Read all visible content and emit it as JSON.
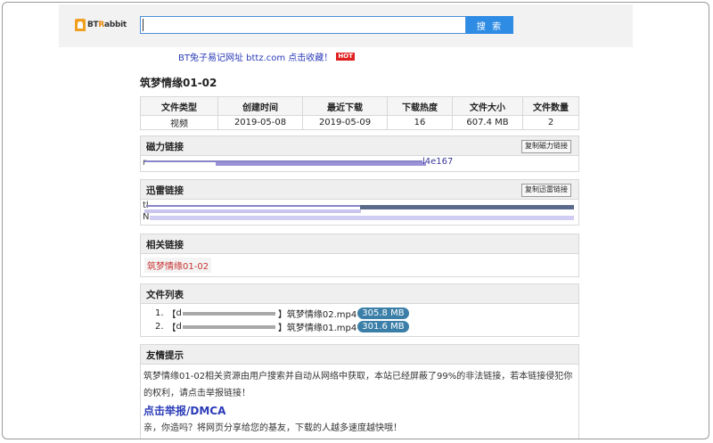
{
  "logo": {
    "text_prefix": "BT",
    "text_r": "R",
    "text_suffix": "abbit"
  },
  "search": {
    "value": "",
    "button_label": "搜 索"
  },
  "promo": {
    "text": "BT兔子易记网址 bttz.com 点击收藏！",
    "hot_badge": "HOT"
  },
  "page_title": "筑梦情缘01-02",
  "info_table": {
    "headers": [
      "文件类型",
      "创建时间",
      "最近下载",
      "下载热度",
      "文件大小",
      "文件数量"
    ],
    "values": [
      "视频",
      "2019-05-08",
      "2019-05-09",
      "16",
      "607.4 MB",
      "2"
    ]
  },
  "magnet": {
    "title": "磁力链接",
    "copy_label": "复制磁力链接",
    "link_start": "r",
    "link_tail": "l4e167"
  },
  "thunder": {
    "title": "迅雷链接",
    "copy_label": "复制迅雷链接",
    "line1_start": "tl",
    "line2_start": "N"
  },
  "related": {
    "title": "相关链接",
    "link": "筑梦情缘01-02"
  },
  "files": {
    "title": "文件列表",
    "items": [
      {
        "index": "1.",
        "open": "【",
        "prefix": "d",
        "close": "】",
        "name": "筑梦情缘02.mp4",
        "size": "305.8 MB"
      },
      {
        "index": "2.",
        "open": "【",
        "prefix": "d",
        "close": "】",
        "name": "筑梦情缘01.mp4",
        "size": "301.6 MB"
      }
    ]
  },
  "notice": {
    "title": "友情提示",
    "paragraph": "筑梦情缘01-02相关资源由用户搜索并自动从网络中获取，本站已经屏蔽了99%的非法链接，若本链接侵犯你的权利，请点击举报链接！",
    "report_link": "点击举报/DMCA",
    "share": "亲，你造吗？将网页分享给您的基友，下载的人越多速度越快哦！"
  },
  "colors": {
    "accent": "#2f8ce4",
    "link": "#2b3bb8",
    "badge": "#3b7fa8",
    "hot": "#e02020"
  }
}
